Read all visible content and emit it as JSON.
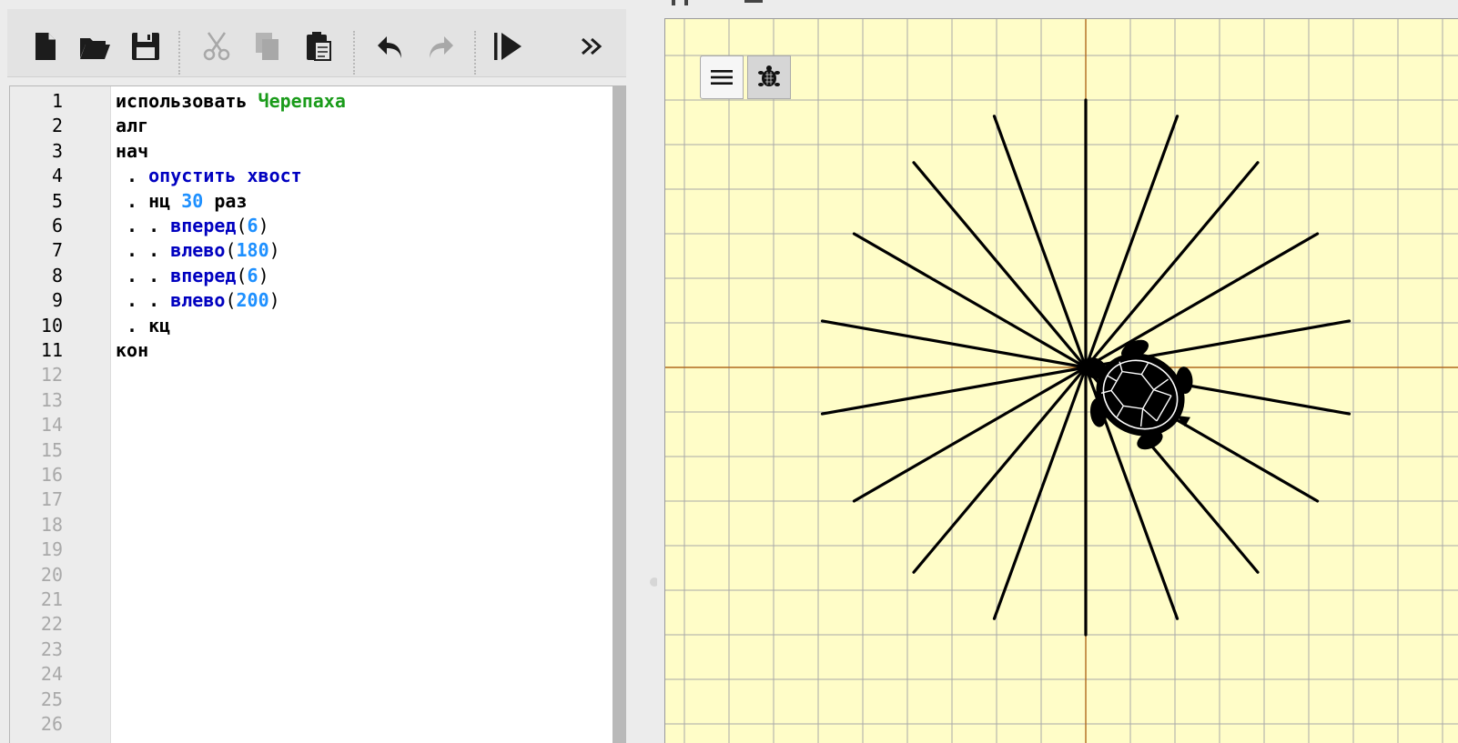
{
  "toolbar": {
    "buttons": [
      {
        "name": "new-file-button",
        "icon": "new-file-icon",
        "enabled": true
      },
      {
        "name": "open-button",
        "icon": "folder-open-icon",
        "enabled": true
      },
      {
        "name": "save-button",
        "icon": "floppy-disk-icon",
        "enabled": true
      },
      {
        "name": "cut-button",
        "icon": "scissors-icon",
        "enabled": false
      },
      {
        "name": "copy-button",
        "icon": "copy-icon",
        "enabled": false
      },
      {
        "name": "paste-button",
        "icon": "paste-icon",
        "enabled": true
      },
      {
        "name": "undo-button",
        "icon": "undo-icon",
        "enabled": true
      },
      {
        "name": "redo-button",
        "icon": "redo-icon",
        "enabled": false
      },
      {
        "name": "run-button",
        "icon": "play-icon",
        "enabled": true
      },
      {
        "name": "more-button",
        "icon": "double-chevron-right-icon",
        "enabled": true
      }
    ]
  },
  "editor": {
    "line_numbers": [
      "1",
      "2",
      "3",
      "4",
      "5",
      "6",
      "7",
      "8",
      "9",
      "10",
      "11",
      "12",
      "13",
      "14",
      "15",
      "16",
      "17",
      "18",
      "19",
      "20",
      "21",
      "22",
      "23",
      "24",
      "25",
      "26"
    ],
    "active_line_count": 11,
    "lines": [
      [
        {
          "t": "использовать ",
          "k": "kw"
        },
        {
          "t": "Черепаха",
          "k": "mod"
        }
      ],
      [
        {
          "t": "алг",
          "k": "kw"
        }
      ],
      [
        {
          "t": "нач",
          "k": "kw"
        }
      ],
      [
        {
          "t": " . ",
          "k": "kw"
        },
        {
          "t": "опустить хвост",
          "k": "fn"
        }
      ],
      [
        {
          "t": " . нц ",
          "k": "kw"
        },
        {
          "t": "30",
          "k": "num"
        },
        {
          "t": " раз",
          "k": "kw"
        }
      ],
      [
        {
          "t": " . . ",
          "k": "kw"
        },
        {
          "t": "вперед",
          "k": "fn"
        },
        {
          "t": "(",
          "k": "p"
        },
        {
          "t": "6",
          "k": "num"
        },
        {
          "t": ")",
          "k": "p"
        }
      ],
      [
        {
          "t": " . . ",
          "k": "kw"
        },
        {
          "t": "влево",
          "k": "fn"
        },
        {
          "t": "(",
          "k": "p"
        },
        {
          "t": "180",
          "k": "num"
        },
        {
          "t": ")",
          "k": "p"
        }
      ],
      [
        {
          "t": " . . ",
          "k": "kw"
        },
        {
          "t": "вперед",
          "k": "fn"
        },
        {
          "t": "(",
          "k": "p"
        },
        {
          "t": "6",
          "k": "num"
        },
        {
          "t": ")",
          "k": "p"
        }
      ],
      [
        {
          "t": " . . ",
          "k": "kw"
        },
        {
          "t": "влево",
          "k": "fn"
        },
        {
          "t": "(",
          "k": "p"
        },
        {
          "t": "200",
          "k": "num"
        },
        {
          "t": ")",
          "k": "p"
        }
      ],
      [
        {
          "t": " . кц",
          "k": "kw"
        }
      ],
      [
        {
          "t": "кон",
          "k": "kw"
        }
      ]
    ]
  },
  "colors": {
    "kw": "#000000",
    "mod": "#1a9b1a",
    "fn": "#0000c0",
    "num": "#1e90ff",
    "p": "#000000",
    "field_bg": "#fffdc8",
    "grid": "#a9a9a9",
    "axis": "#b06a1e",
    "ray": "#000000"
  },
  "turtle_field": {
    "rays": 18,
    "ray_length_units": 6,
    "turn_step_deg": 20,
    "menu_icon": "hamburger-menu-icon",
    "turtle_icon": "turtle-icon"
  }
}
